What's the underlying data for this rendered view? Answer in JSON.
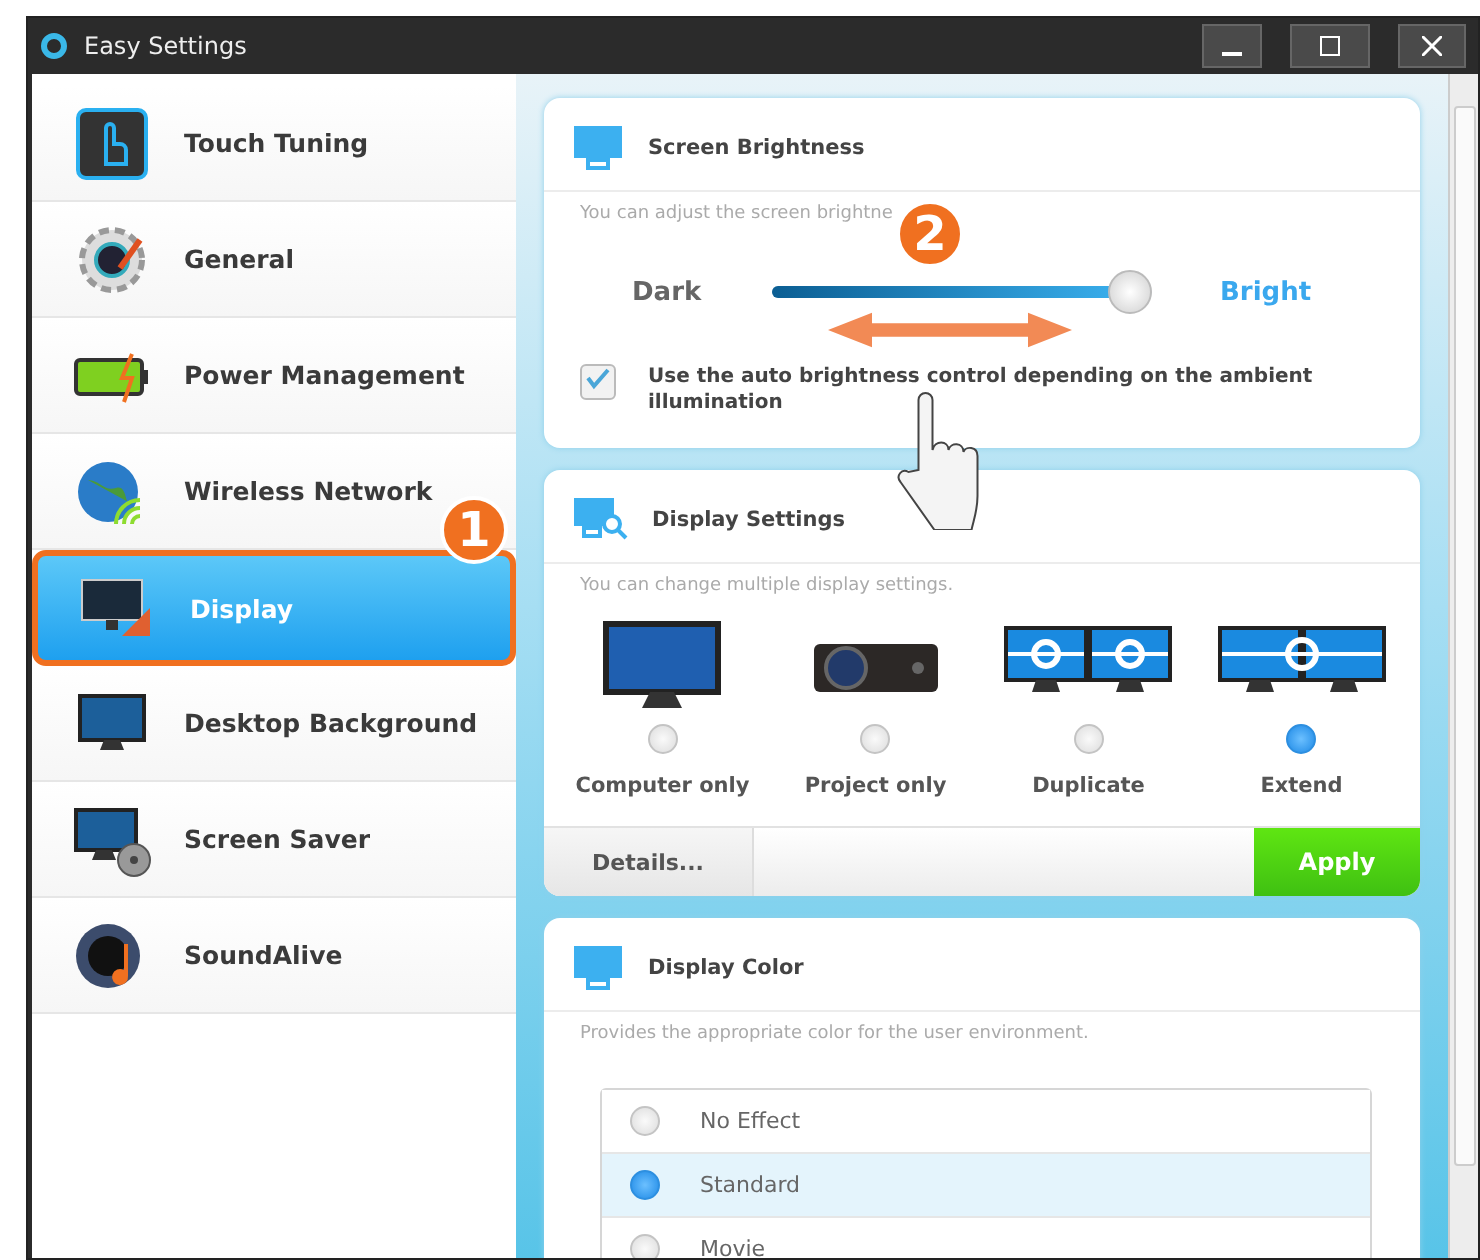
{
  "window": {
    "title": "Easy Settings"
  },
  "sidebar": {
    "items": [
      {
        "label": "Touch Tuning",
        "selected": false
      },
      {
        "label": "General",
        "selected": false
      },
      {
        "label": "Power Management",
        "selected": false
      },
      {
        "label": "Wireless Network",
        "selected": false
      },
      {
        "label": "Display",
        "selected": true
      },
      {
        "label": "Desktop Background",
        "selected": false
      },
      {
        "label": "Screen Saver",
        "selected": false
      },
      {
        "label": "SoundAlive",
        "selected": false
      }
    ]
  },
  "brightness": {
    "title": "Screen Brightness",
    "hint": "You can adjust the screen brightne",
    "min_label": "Dark",
    "max_label": "Bright",
    "level": 0.94,
    "auto": {
      "label": "Use the auto brightness control depending on the ambient illumination",
      "checked": true
    }
  },
  "display_settings": {
    "title": "Display Settings",
    "hint": "You can change multiple display settings.",
    "options": [
      {
        "label": "Computer only",
        "selected": false
      },
      {
        "label": "Project only",
        "selected": false
      },
      {
        "label": "Duplicate",
        "selected": false
      },
      {
        "label": "Extend",
        "selected": true
      }
    ],
    "buttons": {
      "details": "Details...",
      "apply": "Apply"
    }
  },
  "display_color": {
    "title": "Display Color",
    "hint": "Provides the appropriate color for the user environment.",
    "options": [
      {
        "label": "No Effect",
        "selected": false
      },
      {
        "label": "Standard",
        "selected": true
      },
      {
        "label": "Movie",
        "selected": false
      }
    ]
  },
  "annotations": [
    {
      "label": "1"
    },
    {
      "label": "2"
    }
  ]
}
